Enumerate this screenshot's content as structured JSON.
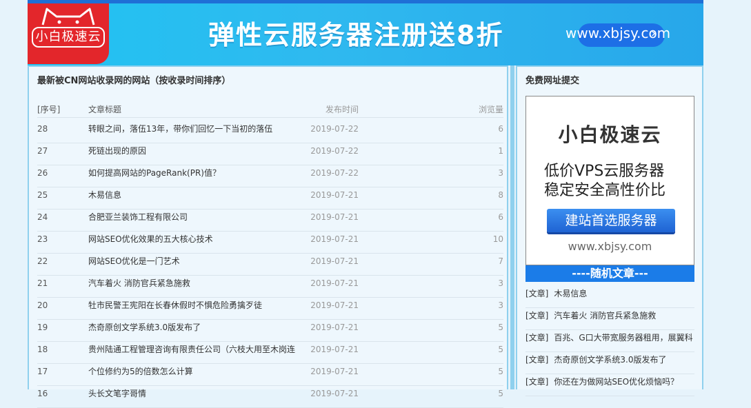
{
  "banner": {
    "logo_text": "小白极速云",
    "slogan": "弹性云服务器注册送8折",
    "url": "www.xbjsy.com",
    "arrow": "›"
  },
  "left_panel": {
    "title": "最新被CN网站收录网的网站（按收录时间排序）",
    "headers": {
      "no": "[序号]",
      "title": "文章标题",
      "date": "发布时间",
      "views": "浏览量"
    },
    "rows": [
      {
        "no": "28",
        "title": "转眼之间，落伍13年，带你们回忆一下当初的落伍",
        "date": "2019-07-22",
        "views": "6"
      },
      {
        "no": "27",
        "title": "死链出现的原因",
        "date": "2019-07-22",
        "views": "1"
      },
      {
        "no": "26",
        "title": "如何提高网站的PageRank(PR)值？",
        "date": "2019-07-22",
        "views": "3"
      },
      {
        "no": "25",
        "title": "木易信息",
        "date": "2019-07-21",
        "views": "8"
      },
      {
        "no": "24",
        "title": "合肥亚兰装饰工程有限公司",
        "date": "2019-07-21",
        "views": "6"
      },
      {
        "no": "23",
        "title": "网站SEO优化效果的五大核心技术",
        "date": "2019-07-21",
        "views": "10"
      },
      {
        "no": "22",
        "title": "网站SEO优化是一门艺术",
        "date": "2019-07-21",
        "views": "7"
      },
      {
        "no": "21",
        "title": "汽车着火 消防官兵紧急施救",
        "date": "2019-07-21",
        "views": "3"
      },
      {
        "no": "20",
        "title": "牡市民警王宪阳在长春休假时不惧危险勇擒歹徒",
        "date": "2019-07-21",
        "views": "3"
      },
      {
        "no": "19",
        "title": "杰奇原创文学系统3.0版发布了",
        "date": "2019-07-21",
        "views": "5"
      },
      {
        "no": "18",
        "title": "贵州陆通工程管理咨询有限责任公司（六枝大用至木岗连",
        "date": "2019-07-21",
        "views": "5"
      },
      {
        "no": "17",
        "title": "个位修约为5的倍数怎么计算",
        "date": "2019-07-21",
        "views": "5"
      },
      {
        "no": "16",
        "title": "头长文笔字哥情",
        "date": "2019-07-21",
        "views": "5"
      }
    ]
  },
  "right_panel": {
    "title": "免费网址提交",
    "ad": {
      "brand": "小白极速云",
      "line1": "低价VPS云服务器",
      "line2": "稳定安全高性价比",
      "button": "建站首选服务器",
      "url": "www.xbjsy.com"
    },
    "random_title": "----随机文章---",
    "random_tag": "[文章]",
    "random_items": [
      "木易信息",
      "汽车着火 消防官兵紧急施救",
      "百兆、G口大带宽服务器租用，展翼科",
      "杰奇原创文学系统3.0版发布了",
      "你还在为做网站SEO优化烦恼吗？"
    ]
  },
  "colors": {
    "page_bg": "#e6f3fb",
    "banner_blue": "#21c3f2",
    "logo_red": "#e3262b",
    "panel_border": "#8fd0ee",
    "random_bar": "#1b7ce8"
  }
}
